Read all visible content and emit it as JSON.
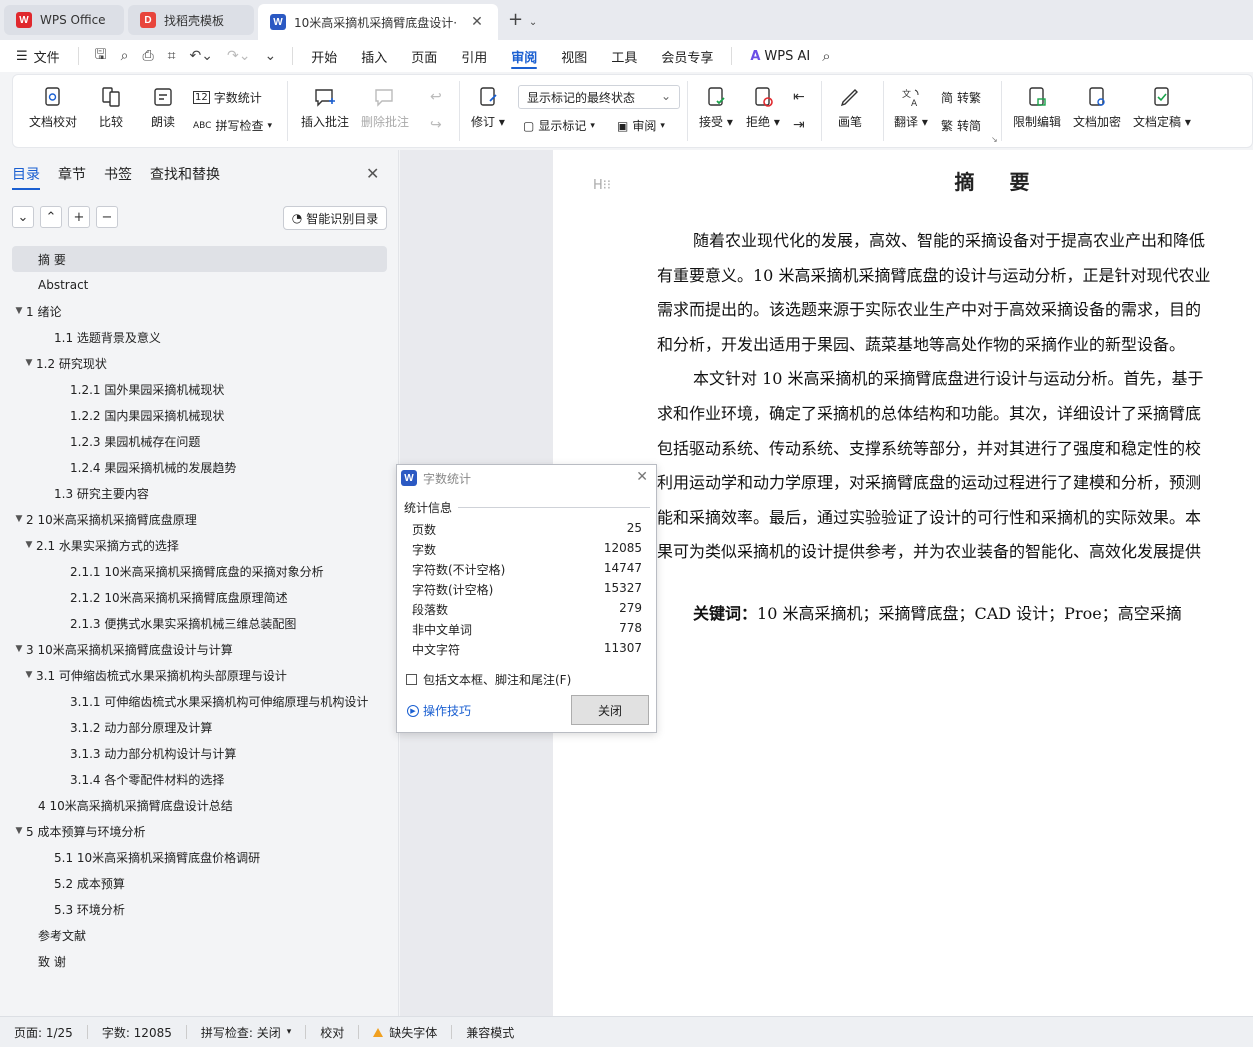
{
  "tabs": [
    {
      "label": "WPS Office",
      "icon": "wps-logo-icon"
    },
    {
      "label": "找稻壳模板",
      "icon": "docer-icon"
    },
    {
      "label": "10米高采摘机采摘臂底盘设计·",
      "icon": "word-doc-icon"
    }
  ],
  "menu": {
    "file_label": "文件",
    "items": [
      "开始",
      "插入",
      "页面",
      "引用",
      "审阅",
      "视图",
      "工具",
      "会员专享"
    ],
    "active": "审阅",
    "wps_ai": "WPS AI"
  },
  "ribbon": {
    "doc_check": "文档校对",
    "compare": "比较",
    "read_aloud": "朗读",
    "word_count": "字数统计",
    "spell_check": "拼写检查",
    "insert_comment": "插入批注",
    "delete_comment": "删除批注",
    "track_changes": "修订",
    "markup_state": "显示标记的最终状态",
    "show_markup": "显示标记",
    "review_pane": "审阅",
    "accept": "接受",
    "reject": "拒绝",
    "ink": "画笔",
    "translate": "翻译",
    "to_traditional": "转繁",
    "to_simplified": "转简",
    "restrict_edit": "限制编辑",
    "encrypt": "文档加密",
    "finalize": "文档定稿"
  },
  "nav": {
    "tabs": [
      "目录",
      "章节",
      "书签",
      "查找和替换"
    ],
    "smart_toc": "智能识别目录",
    "toc": [
      {
        "label": "摘    要",
        "level": 1,
        "arrow": "",
        "selected": true
      },
      {
        "label": "Abstract",
        "level": 1,
        "arrow": ""
      },
      {
        "label": "1  绪论",
        "level": 0,
        "arrow": "▼"
      },
      {
        "label": "1.1  选题背景及意义",
        "level": 2,
        "arrow": ""
      },
      {
        "label": "1.2 研究现状",
        "level": 1.5,
        "arrow": "▼"
      },
      {
        "label": "1.2.1 国外果园采摘机械现状",
        "level": 3,
        "arrow": ""
      },
      {
        "label": "1.2.2 国内果园采摘机械现状",
        "level": 3,
        "arrow": ""
      },
      {
        "label": "1.2.3 果园机械存在问题",
        "level": 3,
        "arrow": ""
      },
      {
        "label": "1.2.4 果园采摘机械的发展趋势",
        "level": 3,
        "arrow": ""
      },
      {
        "label": "1.3 研究主要内容",
        "level": 2,
        "arrow": ""
      },
      {
        "label": "2    10米高采摘机采摘臂底盘原理",
        "level": 0,
        "arrow": "▼"
      },
      {
        "label": "2.1    水果实采摘方式的选择",
        "level": 1.5,
        "arrow": "▼"
      },
      {
        "label": "2.1.1 10米高采摘机采摘臂底盘的采摘对象分析",
        "level": 3,
        "arrow": ""
      },
      {
        "label": "2.1.2 10米高采摘机采摘臂底盘原理简述",
        "level": 3,
        "arrow": ""
      },
      {
        "label": "2.1.3 便携式水果实采摘机械三维总装配图",
        "level": 3,
        "arrow": ""
      },
      {
        "label": "3    10米高采摘机采摘臂底盘设计与计算",
        "level": 0,
        "arrow": "▼"
      },
      {
        "label": "3.1 可伸缩齿梳式水果采摘机构头部原理与设计",
        "level": 1.5,
        "arrow": "▼"
      },
      {
        "label": "3.1.1 可伸缩齿梳式水果采摘机构可伸缩原理与机构设计",
        "level": 3,
        "arrow": ""
      },
      {
        "label": "3.1.2 动力部分原理及计算",
        "level": 3,
        "arrow": ""
      },
      {
        "label": "3.1.3 动力部分机构设计与计算",
        "level": 3,
        "arrow": ""
      },
      {
        "label": "3.1.4 各个零配件材料的选择",
        "level": 3,
        "arrow": ""
      },
      {
        "label": "4    10米高采摘机采摘臂底盘设计总结",
        "level": 1,
        "arrow": ""
      },
      {
        "label": "5  成本预算与环境分析",
        "level": 0,
        "arrow": "▼"
      },
      {
        "label": "5.1    10米高采摘机采摘臂底盘价格调研",
        "level": 2,
        "arrow": ""
      },
      {
        "label": "5.2  成本预算",
        "level": 2,
        "arrow": ""
      },
      {
        "label": "5.3  环境分析",
        "level": 2,
        "arrow": ""
      },
      {
        "label": "参考文献",
        "level": 1,
        "arrow": ""
      },
      {
        "label": "致    谢",
        "level": 1,
        "arrow": ""
      }
    ]
  },
  "document": {
    "title": "摘 要",
    "lines": [
      "随着农业现代化的发展，高效、智能的采摘设备对于提高农业产出和降低",
      "有重要意义。10 米高采摘机采摘臂底盘的设计与运动分析，正是针对现代农业",
      "需求而提出的。该选题来源于实际农业生产中对于高效采摘设备的需求，目的",
      "和分析，开发出适用于果园、蔬菜基地等高处作物的采摘作业的新型设备。",
      "本文针对 10 米高采摘机的采摘臂底盘进行设计与运动分析。首先，基于",
      "求和作业环境，确定了采摘机的总体结构和功能。其次，详细设计了采摘臂底",
      "包括驱动系统、传动系统、支撑系统等部分，并对其进行了强度和稳定性的校",
      "利用运动学和动力学原理，对采摘臂底盘的运动过程进行了建模和分析，预测",
      "能和采摘效率。最后，通过实验验证了设计的可行性和采摘机的实际效果。本",
      "果可为类似采摘机的设计提供参考，并为农业装备的智能化、高效化发展提供"
    ],
    "keywords_label": "关键词：",
    "keywords": "10 米高采摘机；采摘臂底盘；CAD 设计；Proe；高空采摘"
  },
  "dialog": {
    "title": "字数统计",
    "section": "统计信息",
    "stats": [
      {
        "label": "页数",
        "value": "25"
      },
      {
        "label": "字数",
        "value": "12085"
      },
      {
        "label": "字符数(不计空格)",
        "value": "14747"
      },
      {
        "label": "字符数(计空格)",
        "value": "15327"
      },
      {
        "label": "段落数",
        "value": "279"
      },
      {
        "label": "非中文单词",
        "value": "778"
      },
      {
        "label": "中文字符",
        "value": "11307"
      }
    ],
    "checkbox": "包括文本框、脚注和尾注(F)",
    "tips": "操作技巧",
    "close": "关闭"
  },
  "status": {
    "page": "页面: 1/25",
    "words": "字数: 12085",
    "spell": "拼写检查: 关闭",
    "proof": "校对",
    "missing_font": "缺失字体",
    "compat": "兼容模式"
  },
  "colors": {
    "accent": "#1a5fd1",
    "wps_red": "#e0282d",
    "docer_red": "#e8453c",
    "word_blue": "#2b59c3"
  }
}
